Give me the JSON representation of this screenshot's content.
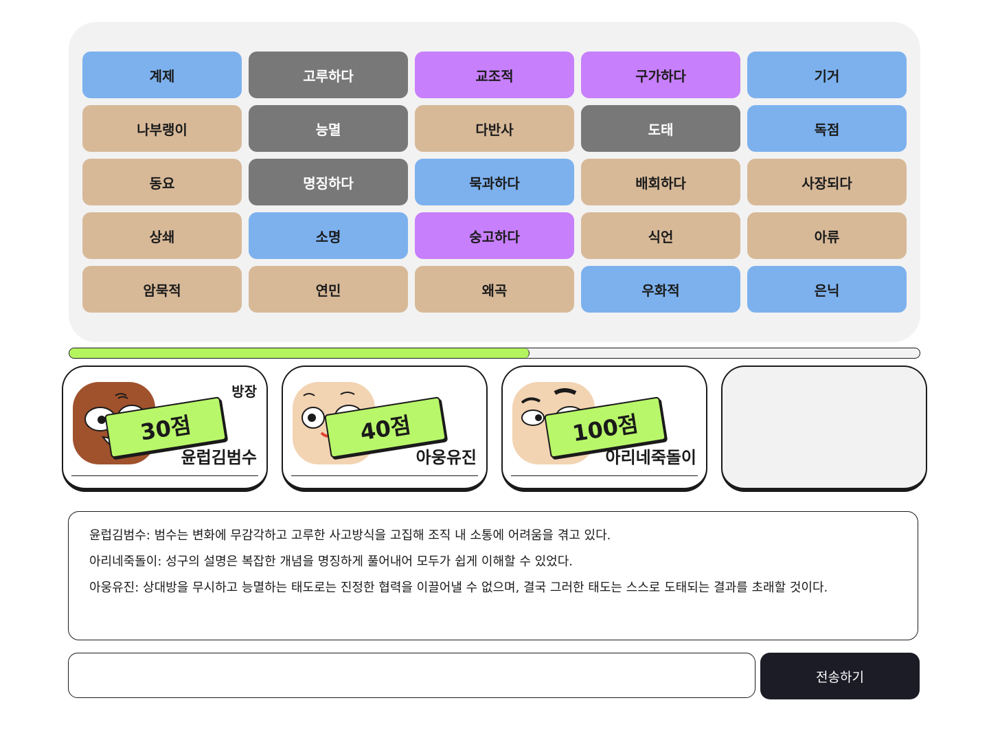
{
  "board": {
    "words": [
      {
        "text": "계제",
        "color": "#7db1ee"
      },
      {
        "text": "고루하다",
        "color": "#787878"
      },
      {
        "text": "교조적",
        "color": "#c77ffb"
      },
      {
        "text": "구가하다",
        "color": "#c77ffb"
      },
      {
        "text": "기거",
        "color": "#7db1ee"
      },
      {
        "text": "나부랭이",
        "color": "#d7b998"
      },
      {
        "text": "능멸",
        "color": "#787878"
      },
      {
        "text": "다반사",
        "color": "#d7b998"
      },
      {
        "text": "도태",
        "color": "#787878"
      },
      {
        "text": "독점",
        "color": "#7db1ee"
      },
      {
        "text": "동요",
        "color": "#d7b998"
      },
      {
        "text": "명징하다",
        "color": "#787878"
      },
      {
        "text": "묵과하다",
        "color": "#7db1ee"
      },
      {
        "text": "배회하다",
        "color": "#d7b998"
      },
      {
        "text": "사장되다",
        "color": "#d7b998"
      },
      {
        "text": "상쇄",
        "color": "#d7b998"
      },
      {
        "text": "소명",
        "color": "#7db1ee"
      },
      {
        "text": "숭고하다",
        "color": "#c77ffb"
      },
      {
        "text": "식언",
        "color": "#d7b998"
      },
      {
        "text": "아류",
        "color": "#d7b998"
      },
      {
        "text": "암묵적",
        "color": "#d7b998"
      },
      {
        "text": "연민",
        "color": "#d7b998"
      },
      {
        "text": "왜곡",
        "color": "#d7b998"
      },
      {
        "text": "우화적",
        "color": "#7db1ee"
      },
      {
        "text": "은닉",
        "color": "#7db1ee"
      }
    ]
  },
  "progress": {
    "fraction": 0.54,
    "fill_color": "#b4f55f"
  },
  "players": [
    {
      "name": "윤럽김범수",
      "score": "30점",
      "host_badge": "방장",
      "avatar": "brown-face",
      "skin": "#a0522d"
    },
    {
      "name": "아웅유진",
      "score": "40점",
      "host_badge": "",
      "avatar": "bald-face",
      "skin": "#f2d3b2"
    },
    {
      "name": "아리네죽돌이",
      "score": "100점",
      "host_badge": "",
      "avatar": "eyebrow-face",
      "skin": "#f2d3b2"
    }
  ],
  "chat": {
    "messages": [
      "윤럽김범수: 범수는 변화에 무감각하고 고루한 사고방식을 고집해 조직 내 소통에 어려움을 겪고 있다.",
      "아리네죽돌이: 성구의 설명은 복잡한 개념을 명징하게 풀어내어 모두가 쉽게 이해할 수 있었다.",
      "아웅유진: 상대방을 무시하고 능멸하는 태도로는 진정한 협력을 이끌어낼 수 없으며, 결국 그러한 태도는 스스로 도태되는 결과를 초래할 것이다."
    ],
    "input_value": "",
    "send_label": "전송하기"
  }
}
